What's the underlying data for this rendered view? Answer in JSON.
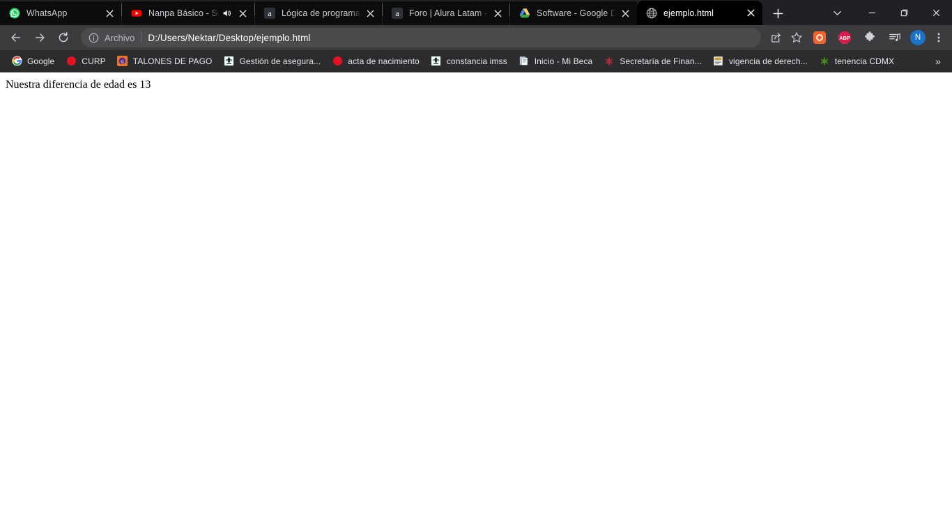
{
  "window": {
    "controls": {
      "tab_search": "chevron-down-icon",
      "minimize": "minimize-icon",
      "maximize": "maximize-icon",
      "close": "close-icon"
    }
  },
  "tabstrip": {
    "new_tab_label": "+",
    "tabs": [
      {
        "title": "WhatsApp",
        "icon": "whatsapp-icon",
        "active": false,
        "audio": false,
        "close_label": "✕"
      },
      {
        "title": "Nanpa Básico - Sin",
        "icon": "youtube-icon",
        "active": false,
        "audio": true,
        "close_label": "✕"
      },
      {
        "title": "Lógica de programaci",
        "icon": "alura-icon",
        "active": false,
        "audio": false,
        "close_label": "✕"
      },
      {
        "title": "Foro | Alura Latam - C",
        "icon": "alura-icon",
        "active": false,
        "audio": false,
        "close_label": "✕"
      },
      {
        "title": "Software - Google Dri",
        "icon": "google-drive-icon",
        "active": false,
        "audio": false,
        "close_label": "✕"
      },
      {
        "title": "ejemplo.html",
        "icon": "globe-icon",
        "active": true,
        "audio": false,
        "close_label": "✕"
      }
    ]
  },
  "toolbar": {
    "back_label": "back-icon",
    "forward_label": "forward-icon",
    "reload_label": "reload-icon",
    "omnibox": {
      "info_icon": "info-circle-icon",
      "scheme_label": "Archivo",
      "url": "D:/Users/Nektar/Desktop/ejemplo.html"
    },
    "actions": [
      {
        "name": "share-icon",
        "type": "glyph"
      },
      {
        "name": "bookmark-star-icon",
        "type": "glyph"
      }
    ],
    "extensions": [
      {
        "name": "orange-o-extension-icon",
        "label": "O",
        "color": "#f5632a"
      },
      {
        "name": "adblock-plus-icon",
        "label": "ABP",
        "color": "#d81b4a"
      },
      {
        "name": "extensions-puzzle-icon",
        "label": "",
        "color": "#cfd0d3"
      },
      {
        "name": "reading-list-music-icon",
        "label": "",
        "color": "#d8d9dc"
      }
    ],
    "profile": {
      "name": "profile-avatar",
      "initial": "N",
      "color": "#1a73c8"
    },
    "menu_label": "three-dot-menu-icon"
  },
  "bookmarks": {
    "overflow_label": "»",
    "items": [
      {
        "label": "Google",
        "icon": "google-g-icon"
      },
      {
        "label": "CURP",
        "icon": "red-circle-icon"
      },
      {
        "label": "TALONES DE PAGO",
        "icon": "talones-q-icon"
      },
      {
        "label": "Gestión de asegura...",
        "icon": "gob-mx-eagle-icon"
      },
      {
        "label": "acta de nacimiento",
        "icon": "red-circle-icon"
      },
      {
        "label": "constancia imss",
        "icon": "gob-mx-eagle-icon"
      },
      {
        "label": "Inicio - Mi Beca",
        "icon": "document-icon"
      },
      {
        "label": "Secretaría de Finan...",
        "icon": "red-asterisk-icon"
      },
      {
        "label": "vigencia de derech...",
        "icon": "imss-doc-icon"
      },
      {
        "label": "tenencia CDMX",
        "icon": "green-asterisk-icon"
      }
    ]
  },
  "page": {
    "body_text": "Nuestra diferencia de edad es 13"
  },
  "colors": {
    "tabstrip_bg": "#202124",
    "active_tab_bg": "#000000",
    "inactive_tab_bg": "#0c0c0d",
    "toolbar_bg": "#3c3c3e",
    "omnibox_bg": "#4b4b4e",
    "bookmarks_bg": "#2c2c2e",
    "page_bg": "#ffffff"
  }
}
